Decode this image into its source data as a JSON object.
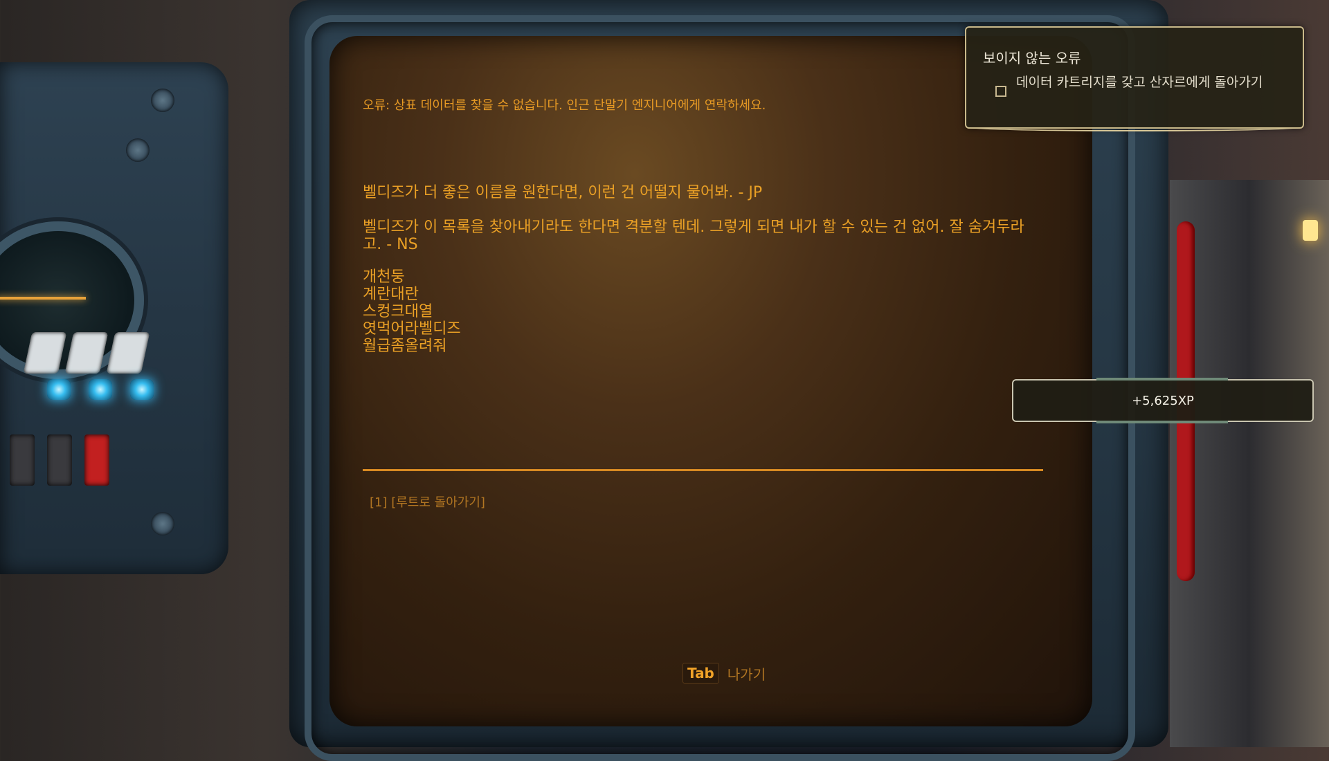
{
  "terminal": {
    "error_text": "오류: 상표 데이터를 찾을 수 없습니다. 인근 단말기 엔지니어에게 연락하세요.",
    "message_1": "벨디즈가 더 좋은 이름을 원한다면, 이런 건 어떨지 물어봐. - JP",
    "message_2": "벨디즈가 이 목록을 찾아내기라도 한다면 격분할 텐데. 그렇게 되면 내가 할 수 있는 건 없어. 잘 숨겨두라고. - NS",
    "names": [
      "개천둥",
      "계란대란",
      "스컹크대열",
      "엿먹어라벨디즈",
      "월급좀올려줘"
    ],
    "option_1": "[1] [루트로 돌아가기]",
    "exit_key": "Tab",
    "exit_label": "나가기"
  },
  "quest": {
    "title": "보이지 않는 오류",
    "objective": "데이터 카트리지를 갖고 산자르에게 돌아가기"
  },
  "xp_toast": {
    "text": "+5,625XP"
  },
  "colors": {
    "terminal_text": "#eaa025",
    "screen_bg": "#33200f",
    "panel_border": "#c9b98a"
  }
}
